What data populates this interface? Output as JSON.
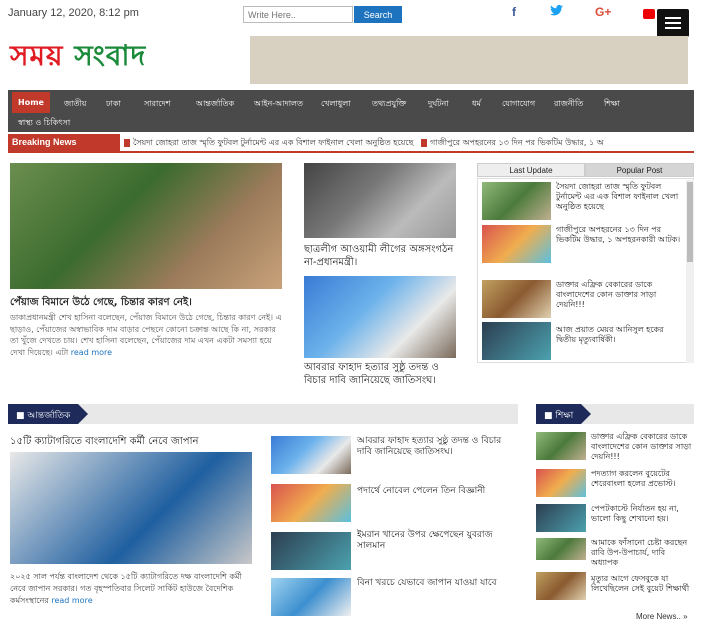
{
  "topbar": {
    "date": "January 12, 2020, 8:12 pm",
    "search_placeholder": "Write Here..",
    "search_button": "Search",
    "facebook": "f",
    "twitter": "t",
    "gplus": "G+"
  },
  "site": {
    "logo_red": "সময়",
    "logo_green": "সংবাদ"
  },
  "nav": {
    "items": [
      "Home",
      "জাতীয়",
      "ঢাকা",
      "সারাদেশ",
      "আন্তর্জাতিক",
      "আইন-আদালত",
      "খেলাধুলা",
      "তথ্যপ্রযুক্তি",
      "দুর্ঘটনা",
      "ধর্ম",
      "যোগাযোগ",
      "রাজনীতি",
      "শিক্ষা",
      "স্বাস্থ্য ও চিকিৎসা"
    ]
  },
  "breaking": {
    "label": "Breaking News",
    "item1": "সৈয়দা জোহরা তাজ স্মৃতি ফুটবল টুর্নামেন্ট এর এক বিশাল ফাইনাল খেলা অনুষ্ঠিত হয়েছে",
    "item2": "গাজীপুরে অপহরনের ১৩ দিন পর ভিকটিম উদ্ধার, ১ অ"
  },
  "lead": {
    "headline": "পেঁয়াজ বিমানে উঠে গেছে, চিন্তার কারণ নেই।",
    "body": "ডাকাপ্রধানমন্ত্রী শেখ হাসিনা বলেছেন, পেঁয়াজ বিমানে উঠে গেছে, চিন্তার কারণ নেই। এ ছাড়াও, পেঁয়াজের অস্বাভাবিক দাম বাড়ার পেছনে কোনো চক্রান্ত আছে কি না, সরকার তা খুঁজে দেখতে চায়। শেখ হাসিনা বলেছেন, পেঁয়াজের দাম এখন একটা সমস্যা হয়ে দেখা দিয়েছে। এটা",
    "more": "read more"
  },
  "mid_stories": [
    "ছাত্রলীগ আওয়ামী লীগের অঙ্গসংগঠন না-প্রধানমন্ত্রী।",
    "আবরার ফাহাদ হত্যার সুষ্ঠু তদন্ত ও বিচার দাবি জানিয়েছে জাতিসংঘ।"
  ],
  "tabs": {
    "latest": "Last Update",
    "popular": "Popular Post"
  },
  "popular": [
    "সৈয়দা জোহরা তাজ স্মৃতি ফুটবল টুর্নামেন্ট এর এক বিশাল ফাইনাল খেলা অনুষ্ঠিত হয়েছে",
    "গাজীপুরে অপহরনের ১৩ দিন পর ভিকটিম উদ্ধার, ১ অপহরনকারী আটক।",
    "ডাক্তার এফ্রিক বেকারের ডাকে বাংলাদেশের কোন ডাক্তার সাড়া দেয়নি!!!",
    "আজ প্রয়াত মেয়র আনিসুল হকের দ্বিতীয় মৃত্যুবার্ষিকী।"
  ],
  "international": {
    "label": "আন্তর্জাতিক",
    "headline": "১৫টি ক্যাটাগরিতে বাংলাদেশি কর্মী নেবে জাপান",
    "body": "২০২৫ সাল পর্যন্ত বাংলাদেশ থেকে ১৫টি ক্যাটাগরিতে দক্ষ বাংলাদেশি কর্মী নেবে জাপান সরকার। গত বৃহস্পতিবার সিলেট সার্কিট হাউজে বৈদেশিক কর্মসংস্থানের",
    "more": "read more",
    "list": [
      "আবরার ফাহাদ হত্যার সুষ্ঠু তদন্ত ও বিচার দাবি জানিয়েছে জাতিসংঘ।",
      "পদার্থে নোবেল পেলেন তিন বিজ্ঞানী",
      "ইমরান খানের উপর ক্ষেপেছেন যুবরাজ সালমান",
      "বিনা খরচে যেভাবে জাপান যাওয়া যাবে"
    ]
  },
  "education": {
    "label": "শিক্ষা",
    "list": [
      "ডাক্তার এফ্রিক বেকারের ডাকে বাংলাদেশের কোন ডাক্তার সাড়া দেয়নি!!!",
      "পদত্যাগ করলেন বুয়েটের শেরেবাংলা হলের প্রভোস্ট।",
      "পেপটকাস্টে নির্যাতন হয় না, ভালো কিছু শেখানো হয়।",
      "আমাকে ফাঁসানো চেষ্টা করছেন রাবি উপ-উপাচার্য, দাবি অধ্যাপক",
      "মৃত্যুর আগে ফেসবুকে যা লিখেছিলেন সেই বুয়েট শিক্ষার্থী"
    ],
    "more": "More News.. »"
  }
}
